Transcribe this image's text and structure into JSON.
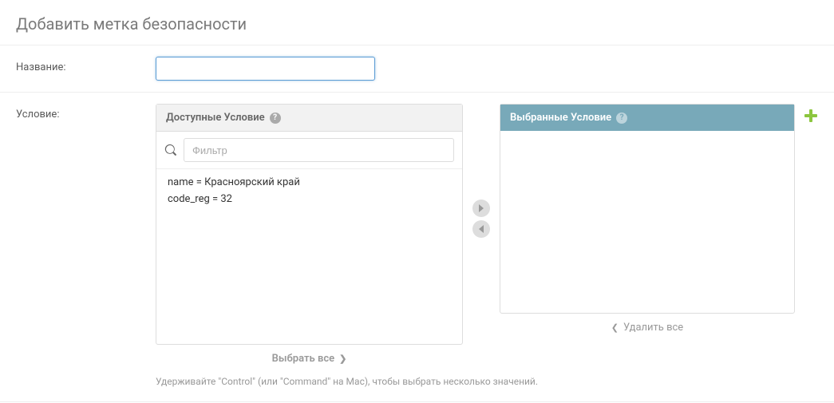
{
  "page_title": "Добавить метка безопасности",
  "fields": {
    "name_label": "Название:",
    "name_value": "",
    "condition_label": "Условие:"
  },
  "available": {
    "header": "Доступные Условие",
    "filter_placeholder": "Фильтр",
    "items": [
      "name = Красноярский край",
      "code_reg = 32"
    ],
    "select_all": "Выбрать все"
  },
  "selected": {
    "header": "Выбранные Условие",
    "remove_all": "Удалить все"
  },
  "hint": "Удерживайте \"Control\" (или \"Command\" на Mac), чтобы выбрать несколько значений."
}
